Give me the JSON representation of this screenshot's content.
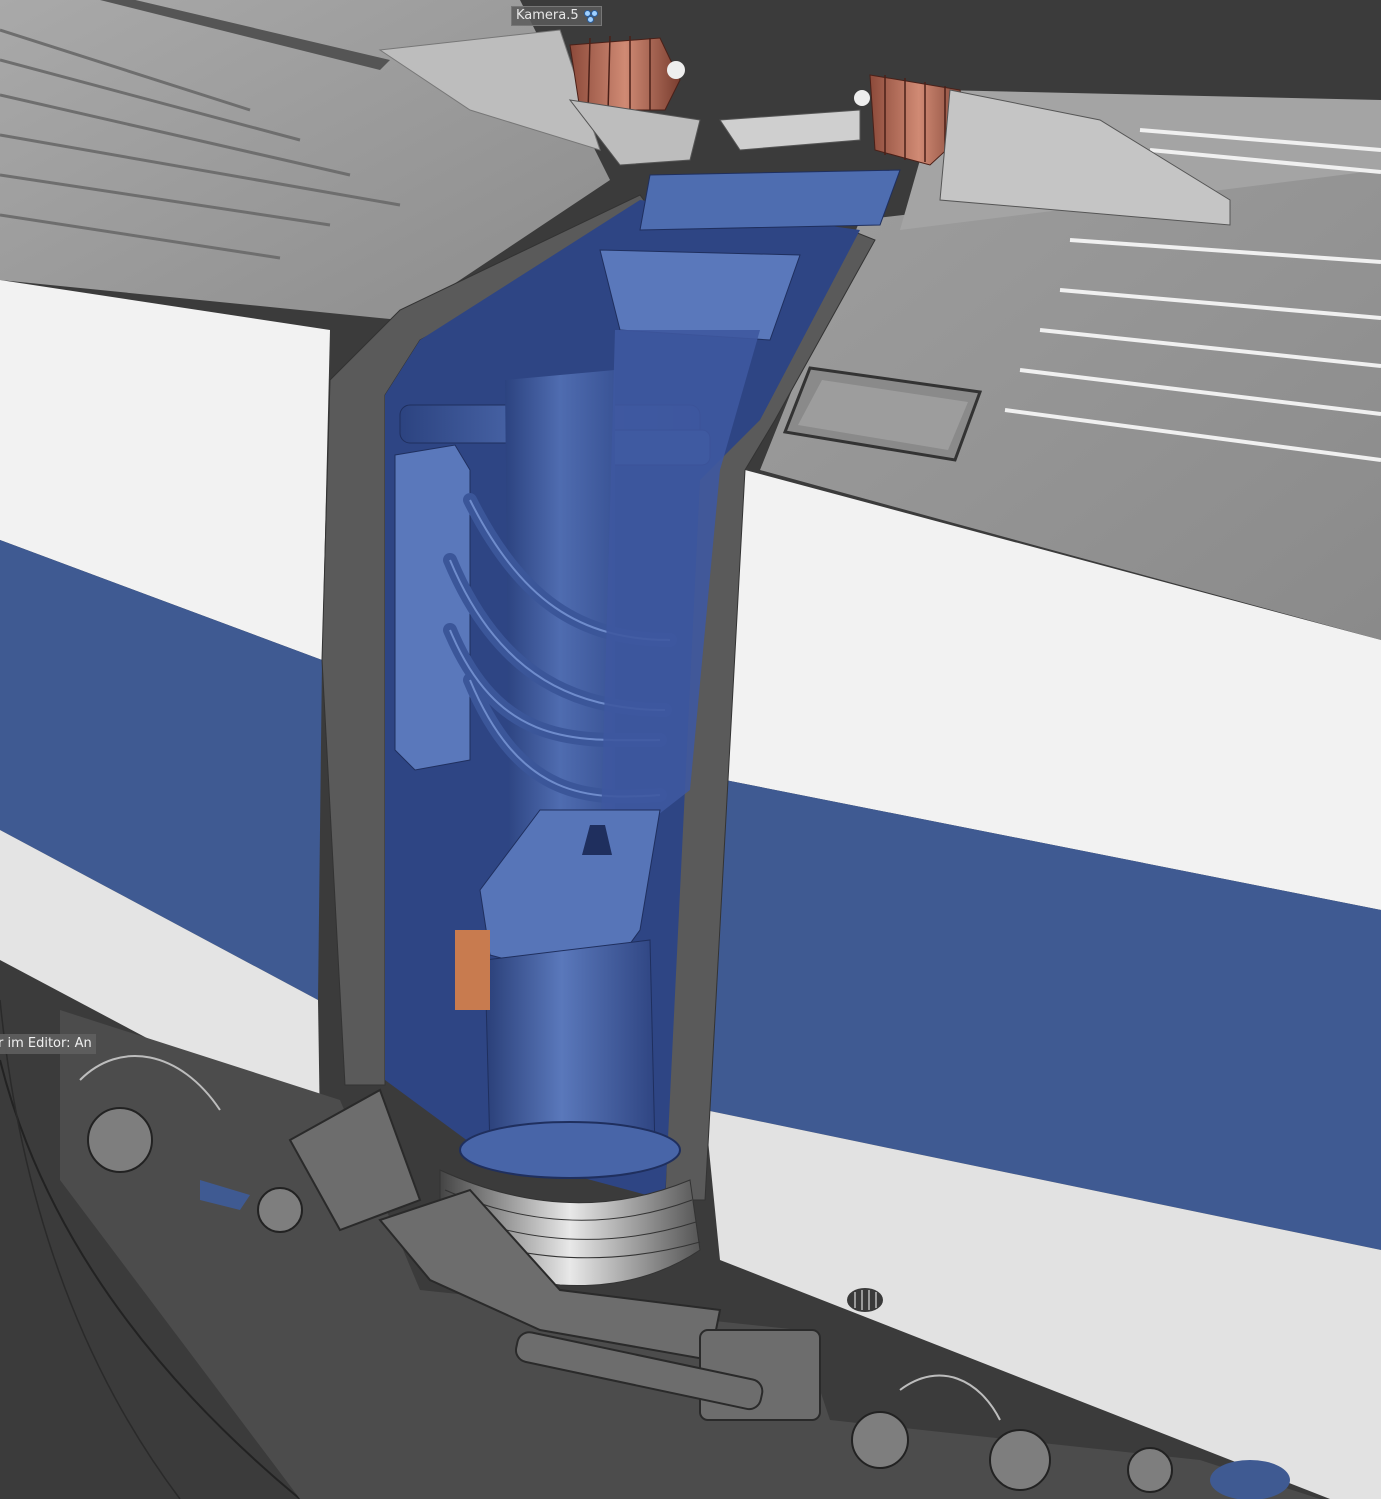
{
  "viewport": {
    "camera_label": "Kamera.5",
    "camera_icon": "camera-dots-icon",
    "editor_tag": "r im Editor: An"
  },
  "colors": {
    "background": "#3c3c3c",
    "roof_gray": "#9a9a9a",
    "body_white": "#f2f2f2",
    "stripe_blue": "#3f5a92",
    "interior_blue": "#4a66a8",
    "insulator_copper": "#b8715e",
    "frame_dark": "#555555"
  }
}
